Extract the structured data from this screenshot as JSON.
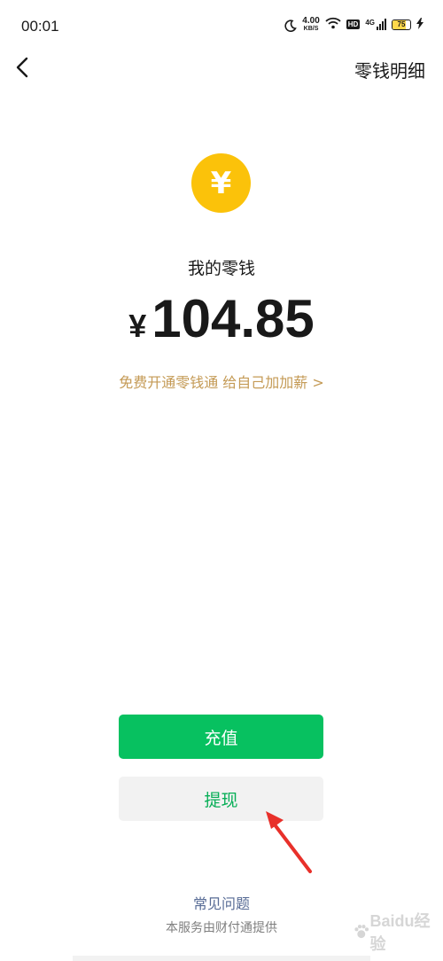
{
  "status_bar": {
    "time": "00:01",
    "net_speed_value": "4.00",
    "net_speed_unit": "KB/S",
    "hd_label": "HD",
    "network_label": "4G",
    "battery_level": "75",
    "battery_fraction": 0.75,
    "icons": [
      "moon-icon",
      "wifi-icon",
      "signal-icon",
      "battery-icon",
      "charging-icon"
    ]
  },
  "nav": {
    "back_icon": "chevron-left-icon",
    "title": "零钱明细"
  },
  "wallet": {
    "coin_icon": "yuan-coin-icon",
    "coin_symbol": "¥",
    "balance_label": "我的零钱",
    "currency_symbol": "¥",
    "balance_amount": "104.85",
    "promo_text": "免费开通零钱通 给自己加加薪 >"
  },
  "actions": {
    "topup_label": "充值",
    "withdraw_label": "提现"
  },
  "footer": {
    "faq_label": "常见问题",
    "provider_note": "本服务由财付通提供"
  },
  "watermark": {
    "text": "Baidu经验"
  },
  "colors": {
    "primary_green": "#07c160",
    "withdraw_text": "#06ae56",
    "coin_yellow": "#fbc20a",
    "promo_gold": "#c49a55",
    "link_blue": "#576b95",
    "annotation_red": "#e8302a"
  }
}
